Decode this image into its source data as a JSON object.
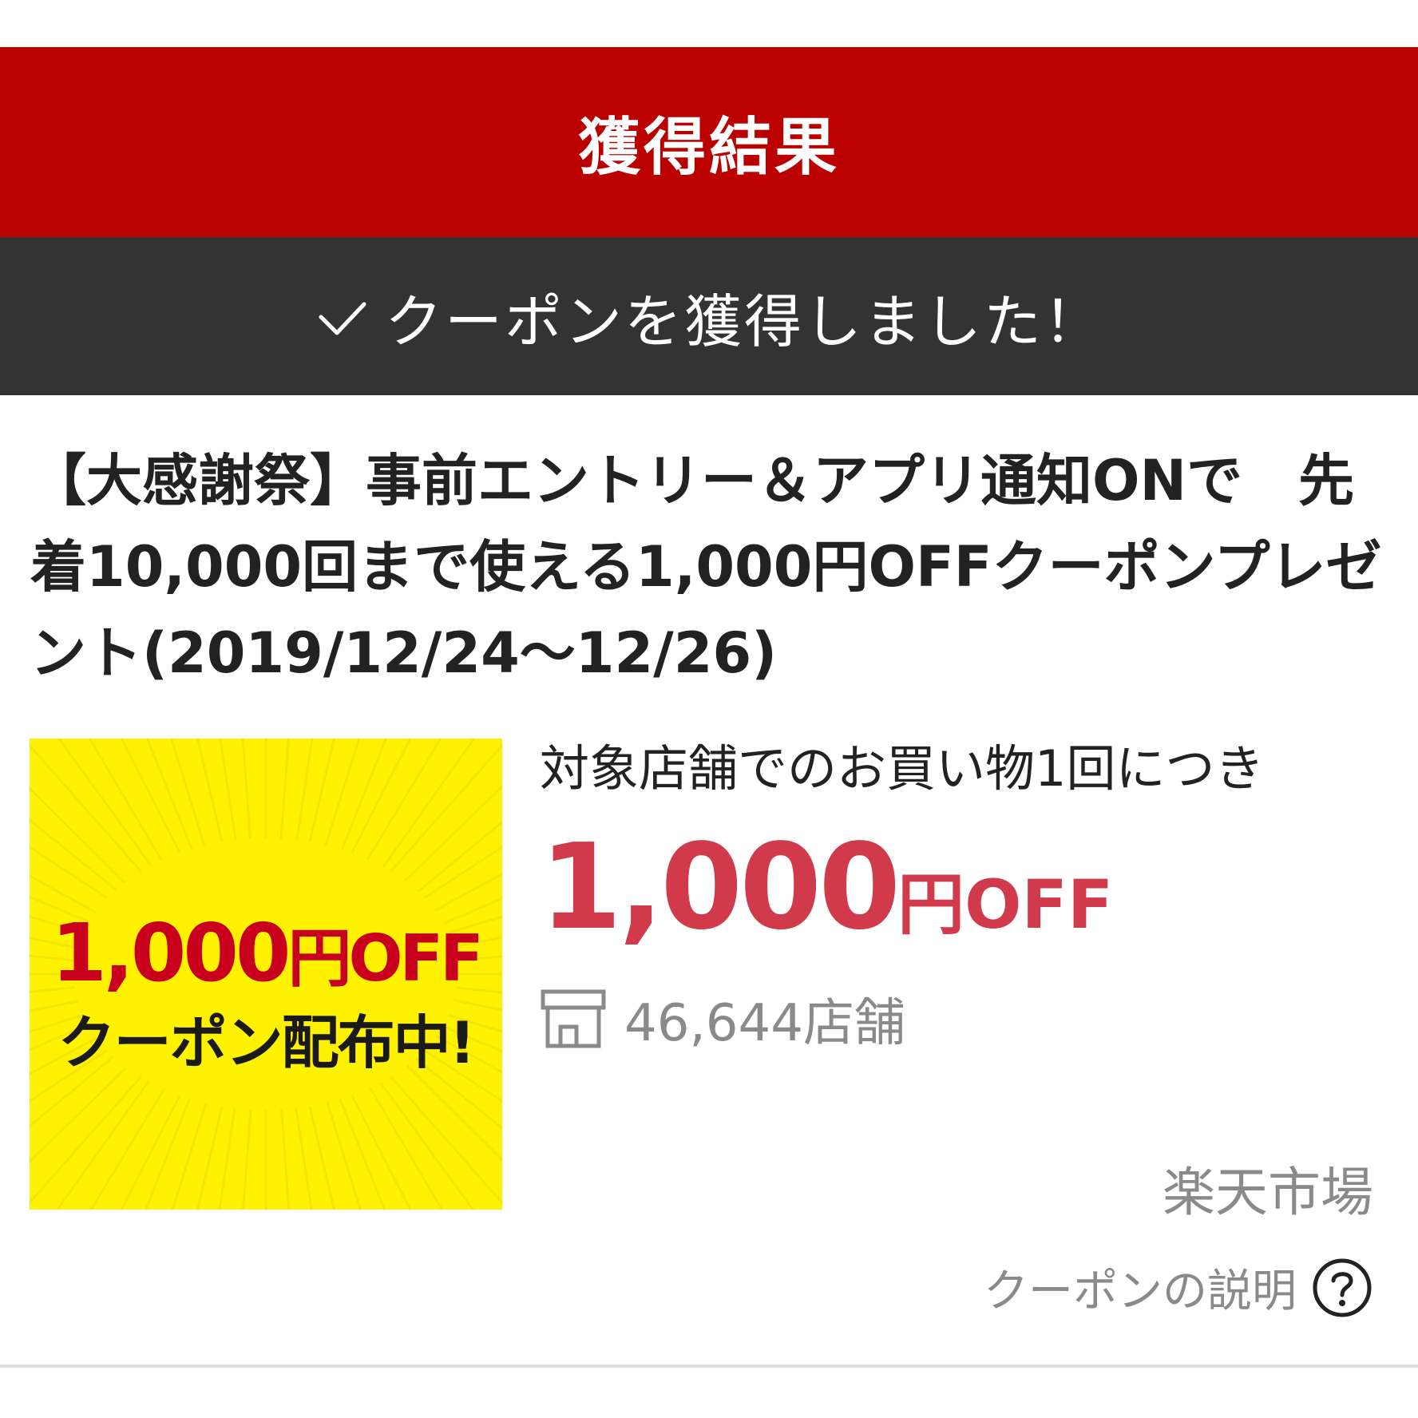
{
  "colors": {
    "header_red": "#bb0000",
    "status_dark": "#333333",
    "price_red": "#d03a4a",
    "banner_yellow": "#fff200",
    "banner_red": "#c8001e",
    "muted_gray": "#8a8a8a"
  },
  "header": {
    "title": "獲得結果"
  },
  "status": {
    "icon": "check-icon",
    "message": "クーポンを獲得しました！"
  },
  "coupon": {
    "title": "【大感謝祭】事前エントリー＆アプリ通知ONで　先着10,000回まで使える1,000円OFFクーポンプレゼント(2019/12/24〜12/26)",
    "banner": {
      "amount": "1,000",
      "unit": "円OFF",
      "subtitle": "クーポン配布中!"
    },
    "condition": "対象店舗でのお買い物1回につき",
    "discount_amount": "1,000",
    "discount_unit": "円OFF",
    "shop_icon": "store-icon",
    "shop_count": "46,644店舗",
    "market": "楽天市場",
    "explain_label": "クーポンの説明",
    "explain_icon": "help-icon"
  }
}
